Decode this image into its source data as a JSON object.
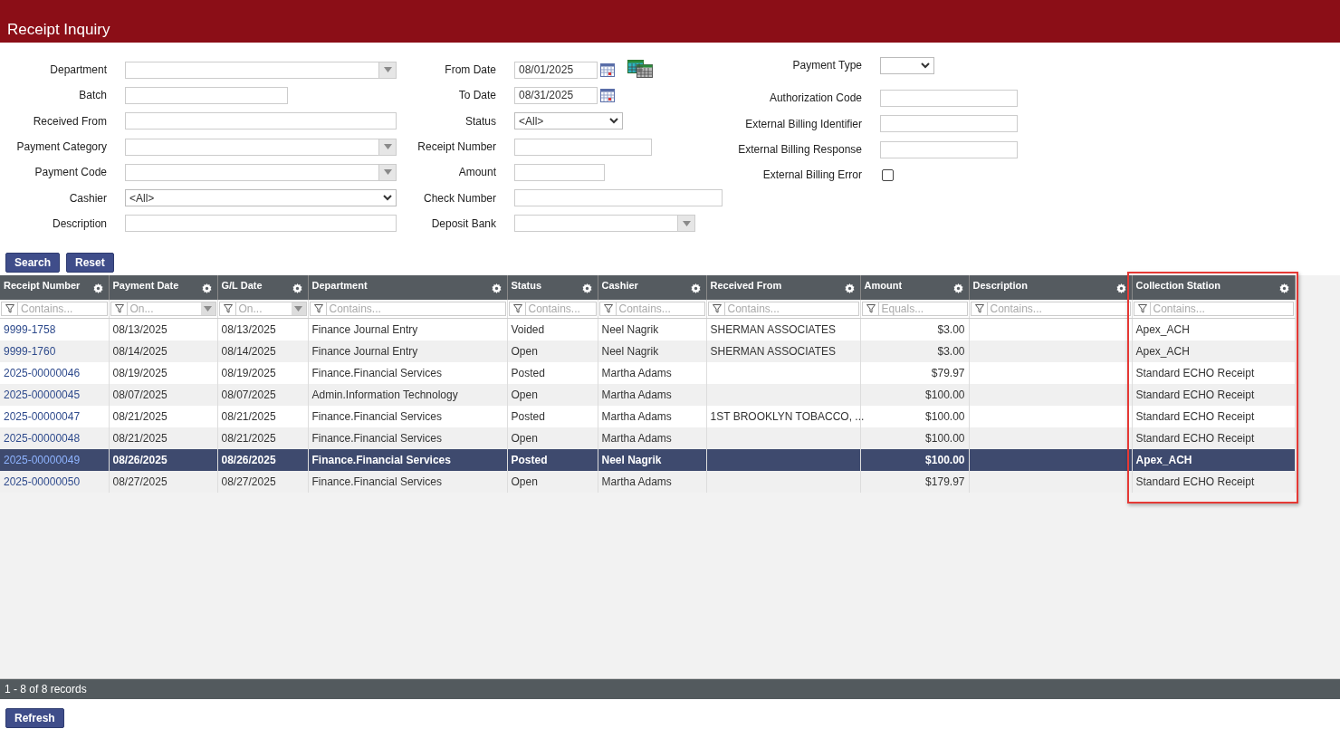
{
  "title": "Receipt Inquiry",
  "form": {
    "columns": [
      [
        {
          "label": "Department",
          "kind": "combo"
        },
        {
          "label": "Batch",
          "kind": "text"
        },
        {
          "label": "Received From",
          "kind": "text"
        },
        {
          "label": "Payment Category",
          "kind": "combo"
        },
        {
          "label": "Payment Code",
          "kind": "combo"
        },
        {
          "label": "Cashier",
          "kind": "select",
          "value": "<All>"
        },
        {
          "label": "Description",
          "kind": "text"
        }
      ],
      [
        {
          "label": "From Date",
          "kind": "date",
          "value": "08/01/2025",
          "range_icon": true
        },
        {
          "label": "To Date",
          "kind": "date",
          "value": "08/31/2025",
          "range_icon": false
        },
        {
          "label": "Status",
          "kind": "select",
          "value": "<All>"
        },
        {
          "label": "Receipt Number",
          "kind": "text"
        },
        {
          "label": "Amount",
          "kind": "text"
        },
        {
          "label": "Check Number",
          "kind": "text"
        },
        {
          "label": "Deposit Bank",
          "kind": "combo"
        }
      ],
      [
        {
          "label": "Payment Type",
          "kind": "select"
        },
        {
          "label": "Authorization Code",
          "kind": "text"
        },
        {
          "label": "External Billing Identifier",
          "kind": "text"
        },
        {
          "label": "External Billing Response",
          "kind": "text"
        },
        {
          "label": "External Billing Error",
          "kind": "checkbox",
          "checked": false
        }
      ]
    ]
  },
  "buttons": [
    "Search",
    "Reset"
  ],
  "grid": {
    "columns": [
      {
        "name": "Receipt Number",
        "kind": "link",
        "filter": "Contains...",
        "highlighted": false
      },
      {
        "name": "Payment Date",
        "kind": "date",
        "filter": "On...",
        "highlighted": false
      },
      {
        "name": "G/L Date",
        "kind": "date",
        "filter": "On...",
        "highlighted": false
      },
      {
        "name": "Department",
        "kind": "text",
        "filter": "Contains...",
        "highlighted": false
      },
      {
        "name": "Status",
        "kind": "text",
        "filter": "Contains...",
        "highlighted": false
      },
      {
        "name": "Cashier",
        "kind": "text",
        "filter": "Contains...",
        "highlighted": false
      },
      {
        "name": "Received From",
        "kind": "text",
        "filter": "Contains...",
        "highlighted": false
      },
      {
        "name": "Amount",
        "kind": "money",
        "filter": "Equals...",
        "highlighted": false
      },
      {
        "name": "Description",
        "kind": "text",
        "filter": "Contains...",
        "highlighted": false
      },
      {
        "name": "Collection Station",
        "kind": "text",
        "filter": "Contains...",
        "highlighted": true
      }
    ],
    "rows": [
      {
        "selected": false,
        "cells": [
          "9999-1758",
          "08/13/2025",
          "08/13/2025",
          "Finance Journal Entry",
          "Voided",
          "Neel Nagrik",
          "SHERMAN ASSOCIATES",
          "$3.00",
          null,
          "Apex_ACH"
        ]
      },
      {
        "selected": false,
        "cells": [
          "9999-1760",
          "08/14/2025",
          "08/14/2025",
          "Finance Journal Entry",
          "Open",
          "Neel Nagrik",
          "SHERMAN ASSOCIATES",
          "$3.00",
          null,
          "Apex_ACH"
        ]
      },
      {
        "selected": false,
        "cells": [
          "2025-00000046",
          "08/19/2025",
          "08/19/2025",
          "Finance.Financial Services",
          "Posted",
          "Martha Adams",
          null,
          "$79.97",
          null,
          "Standard ECHO Receipt"
        ]
      },
      {
        "selected": false,
        "cells": [
          "2025-00000045",
          "08/07/2025",
          "08/07/2025",
          "Admin.Information Technology",
          "Open",
          "Martha Adams",
          null,
          "$100.00",
          null,
          "Standard ECHO Receipt"
        ]
      },
      {
        "selected": false,
        "cells": [
          "2025-00000047",
          "08/21/2025",
          "08/21/2025",
          "Finance.Financial Services",
          "Posted",
          "Martha Adams",
          "1ST BROOKLYN TOBACCO, ...",
          "$100.00",
          null,
          "Standard ECHO Receipt"
        ]
      },
      {
        "selected": false,
        "cells": [
          "2025-00000048",
          "08/21/2025",
          "08/21/2025",
          "Finance.Financial Services",
          "Open",
          "Martha Adams",
          null,
          "$100.00",
          null,
          "Standard ECHO Receipt"
        ]
      },
      {
        "selected": true,
        "cells": [
          "2025-00000049",
          "08/26/2025",
          "08/26/2025",
          "Finance.Financial Services",
          "Posted",
          "Neel Nagrik",
          null,
          "$100.00",
          null,
          "Apex_ACH"
        ]
      },
      {
        "selected": false,
        "cells": [
          "2025-00000050",
          "08/27/2025",
          "08/27/2025",
          "Finance.Financial Services",
          "Open",
          "Martha Adams",
          null,
          "$179.97",
          null,
          "Standard ECHO Receipt"
        ]
      }
    ],
    "footer": "1 - 8 of 8 records"
  },
  "refresh_button": "Refresh"
}
